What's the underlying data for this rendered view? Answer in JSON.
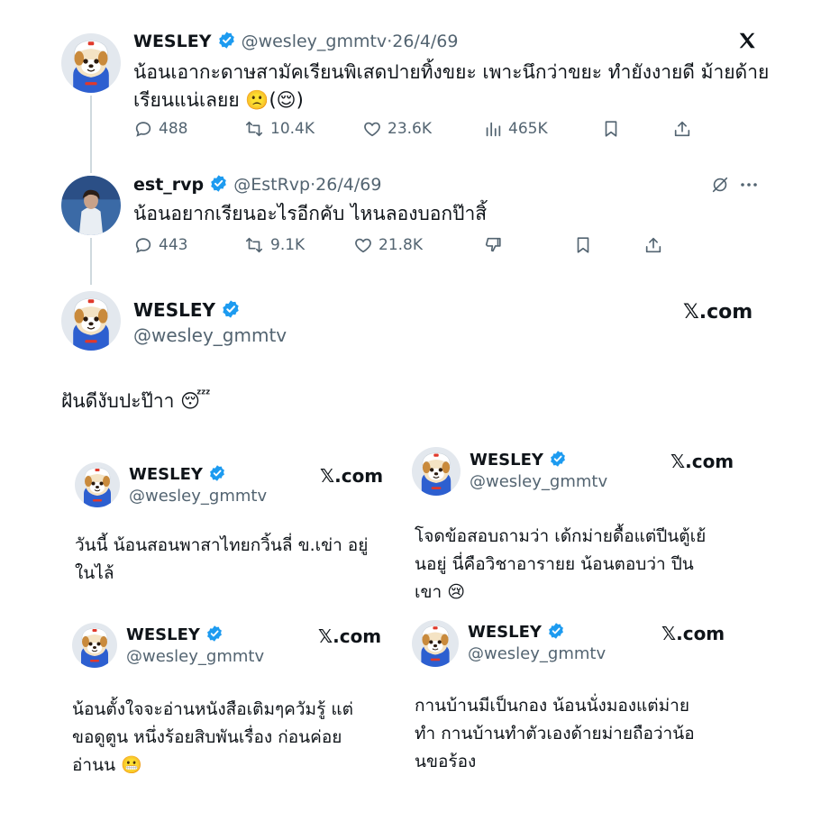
{
  "tweet1": {
    "name": "WESLEY",
    "handle": "@wesley_gmmtv",
    "date": "26/4/69",
    "text_line1": "น้อนเอากะดาษสามัคเรียนพิเสดปายทิ้งขยะ เพาะนึกว่าขยะ ทำยังงายดี ม้ายด้าย",
    "text_line2": "เรียนแน่เลยย 🙁(😌)",
    "replies": "488",
    "retweets": "10.4K",
    "likes": "23.6K",
    "views": "465K"
  },
  "tweet2": {
    "name": "est_rvp",
    "handle": "@EstRvp",
    "date": "26/4/69",
    "text": "น้อนอยากเรียนอะไรอีกคับ ไหนลองบอกป๊าสิ้",
    "replies": "443",
    "retweets": "9.1K",
    "likes": "21.8K"
  },
  "quoted": {
    "name": "WESLEY",
    "handle": "@wesley_gmmtv",
    "site": "𝕏.com",
    "text": "ฝันดีงับปะป๊าา 😴"
  },
  "cards": [
    {
      "name": "WESLEY",
      "handle": "@wesley_gmmtv",
      "site": "𝕏.com",
      "line1": "วันนี้ น้อนสอนพาสาไทยกวิ้นลี่ ข.เข่า อยู่",
      "line2": "ในไล้",
      "line3": ""
    },
    {
      "name": "WESLEY",
      "handle": "@wesley_gmmtv",
      "site": "𝕏.com",
      "line1": "โจดข้อสอบถามว่า เด้กม่ายดื้อแต่ปีนตู้เย้",
      "line2": "นอยู่ นี่คือวิชาอารายย น้อนตอบว่า ปีน",
      "line3": "เขา 😢"
    },
    {
      "name": "WESLEY",
      "handle": "@wesley_gmmtv",
      "site": "𝕏.com",
      "line1": "น้อนตั้งใจจะอ่านหนังสือเติมๆควัมรู้ แต่",
      "line2": "ขอดูตูน หนึ่งร้อยสิบพันเรื่อง ก่อนค่อย",
      "line3": "อ่านน 😬"
    },
    {
      "name": "WESLEY",
      "handle": "@wesley_gmmtv",
      "site": "𝕏.com",
      "line1": "กานบ้านมีเป็นกอง น้อนนั่งมองแต่ม่าย",
      "line2": "ทำ กานบ้านทำตัวเองด้ายม่ายถือว่าน้อ",
      "line3": "นขอร้อง"
    }
  ],
  "colors": {
    "verified": "#1d9bf0",
    "muted": "#536471",
    "line": "#cfd9de"
  },
  "icons": [
    "x-logo-icon",
    "reply-icon",
    "retweet-icon",
    "like-icon",
    "views-icon",
    "bookmark-icon",
    "share-icon",
    "grok-icon",
    "more-icon",
    "dislike-icon",
    "verified-icon"
  ]
}
